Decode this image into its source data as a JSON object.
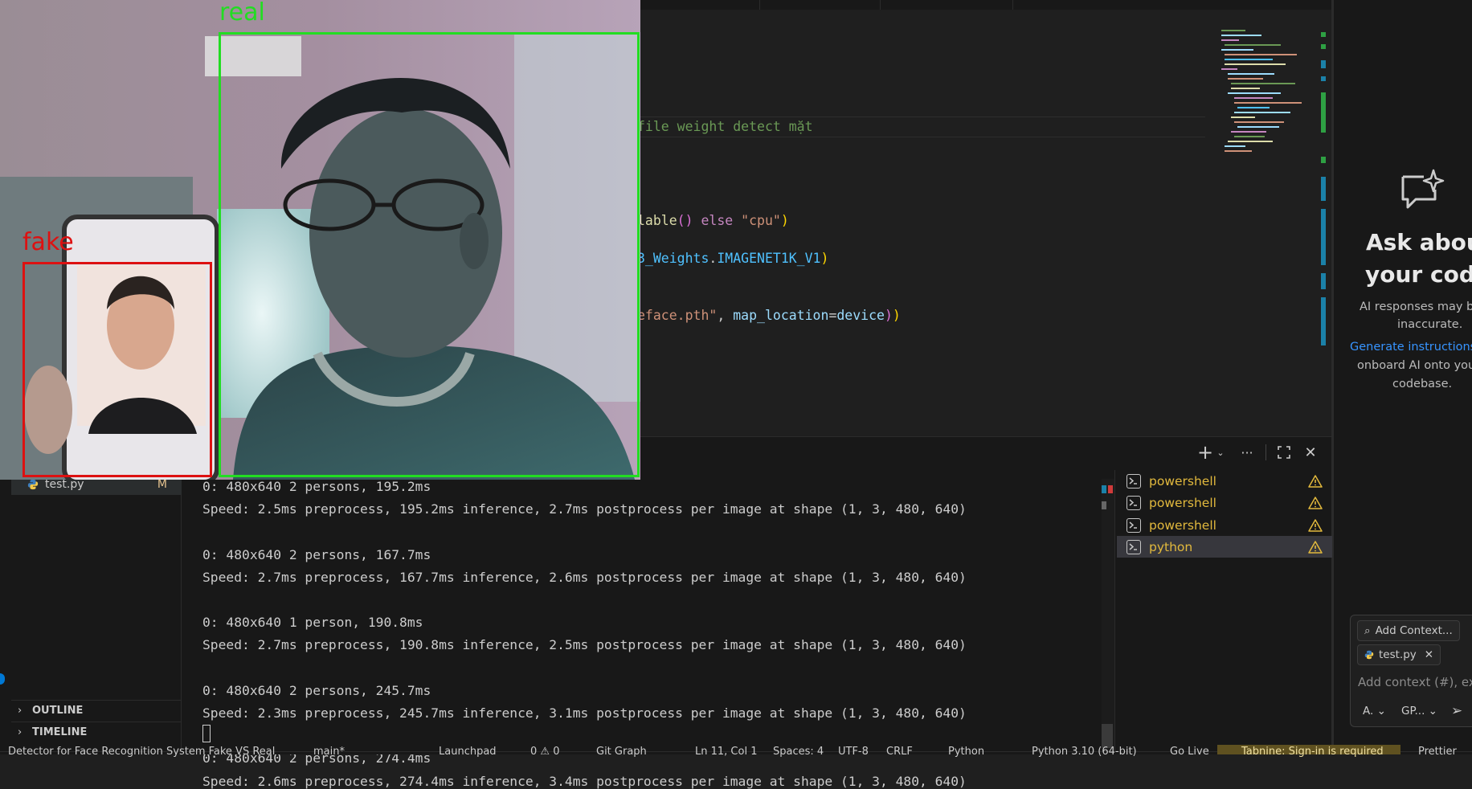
{
  "editor": {
    "code_lines": [
      {
        "parts": [
          {
            "cls": "tk-comment",
            "text": "file weight detect mặt"
          }
        ]
      },
      {
        "parts": [
          {
            "cls": "tk-fn",
            "text": "lable"
          },
          {
            "cls": "tk-paren2",
            "text": "()"
          },
          {
            "cls": "",
            "text": " "
          },
          {
            "cls": "tk-kw",
            "text": "else"
          },
          {
            "cls": "",
            "text": " "
          },
          {
            "cls": "tk-str",
            "text": "\"cpu\""
          },
          {
            "cls": "tk-paren",
            "text": ")"
          }
        ]
      },
      {
        "parts": [
          {
            "cls": "tk-ident",
            "text": "3_Weights"
          },
          {
            "cls": "",
            "text": "."
          },
          {
            "cls": "tk-ident",
            "text": "IMAGENET1K_V1"
          },
          {
            "cls": "tk-paren",
            "text": ")"
          }
        ]
      },
      {
        "parts": [
          {
            "cls": "tk-str",
            "text": "eface.pth\""
          },
          {
            "cls": "",
            "text": ", "
          },
          {
            "cls": "tk-var",
            "text": "map_location"
          },
          {
            "cls": "",
            "text": "="
          },
          {
            "cls": "tk-var",
            "text": "device"
          },
          {
            "cls": "tk-paren2",
            "text": ")"
          },
          {
            "cls": "tk-paren",
            "text": ")"
          }
        ]
      }
    ]
  },
  "sidebar": {
    "file": {
      "name": "test.py",
      "badge": "M"
    },
    "sections": [
      {
        "label": "OUTLINE"
      },
      {
        "label": "TIMELINE"
      }
    ]
  },
  "terminal": {
    "lines": [
      "0: 480x640 2 persons, 195.2ms",
      "Speed: 2.5ms preprocess, 195.2ms inference, 2.7ms postprocess per image at shape (1, 3, 480, 640)",
      "",
      "0: 480x640 2 persons, 167.7ms",
      "Speed: 2.7ms preprocess, 167.7ms inference, 2.6ms postprocess per image at shape (1, 3, 480, 640)",
      "",
      "0: 480x640 1 person, 190.8ms",
      "Speed: 2.7ms preprocess, 190.8ms inference, 2.5ms postprocess per image at shape (1, 3, 480, 640)",
      "",
      "0: 480x640 2 persons, 245.7ms",
      "Speed: 2.3ms preprocess, 245.7ms inference, 3.1ms postprocess per image at shape (1, 3, 480, 640)",
      "",
      "0: 480x640 2 persons, 274.4ms",
      "Speed: 2.6ms preprocess, 274.4ms inference, 3.4ms postprocess per image at shape (1, 3, 480, 640)"
    ],
    "sessions": [
      "powershell",
      "powershell",
      "powershell",
      "python"
    ],
    "active_session": 3
  },
  "panel_actions": {
    "new_terminal": "+",
    "more": "···",
    "maximize": "⛶",
    "close": "✕"
  },
  "chat": {
    "title_line1": "Ask about",
    "title_line2": "your code",
    "disclaimer_line1": "AI responses may b",
    "disclaimer_line2": "inaccurate.",
    "link_text": "Generate instructions",
    "onboard_line1": "onboard AI onto you",
    "onboard_line2": "codebase.",
    "add_context": "Add Context...",
    "context_file": "test.py",
    "placeholder": "Add context (#), ext",
    "mode": "A.",
    "model": "GP..."
  },
  "statusbar": {
    "repo": "Detector for Face Recognition System Fake VS Real",
    "branch": "main*",
    "launchpad": "Launchpad",
    "problems": "0 ⚠ 0",
    "git_graph": "Git Graph",
    "position": "Ln 11, Col 1",
    "spaces": "Spaces: 4",
    "encoding": "UTF-8",
    "eol": "CRLF",
    "language": "Python",
    "interpreter": "Python 3.10 (64-bit)",
    "go_live": "Go Live",
    "tabnine": "Tabnine: Sign-in is required",
    "prettier": "Prettier"
  },
  "camera": {
    "label_real": "real",
    "label_fake": "fake",
    "color_real": "#22dd22",
    "color_fake": "#dd1111"
  },
  "colors": {
    "accent": "#0078d4",
    "warning_text": "#e2b93d",
    "link": "#3794ff"
  }
}
